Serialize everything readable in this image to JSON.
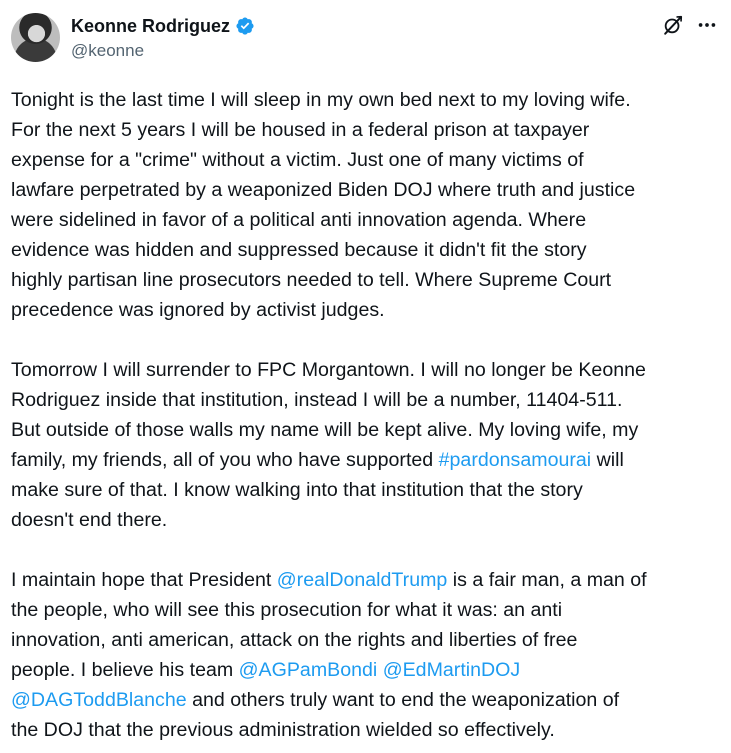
{
  "author": {
    "display_name": "Keonne Rodriguez",
    "handle": "@keonne",
    "verified": true,
    "verified_color": "#1d9bf0"
  },
  "actions": {
    "grok_icon": "grok-icon",
    "more_icon": "more-horizontal-icon"
  },
  "colors": {
    "text": "#0f1419",
    "secondary": "#536471",
    "link": "#1d9bf0"
  },
  "paragraphs": [
    {
      "lines": [
        [
          {
            "t": "Tonight is the last time I will sleep in my own bed next to my loving wife."
          }
        ],
        [
          {
            "t": "For the next 5 years I will be housed in a federal prison at taxpayer"
          }
        ],
        [
          {
            "t": "expense for a \"crime\" without a victim. Just one of many victims of"
          }
        ],
        [
          {
            "t": "lawfare perpetrated by a weaponized Biden DOJ where truth and justice"
          }
        ],
        [
          {
            "t": "were sidelined in favor of a political anti innovation agenda. Where"
          }
        ],
        [
          {
            "t": "evidence was hidden and suppressed because it didn't fit the story"
          }
        ],
        [
          {
            "t": "highly partisan line prosecutors needed to tell. Where Supreme Court"
          }
        ],
        [
          {
            "t": "precedence was ignored by activist judges."
          }
        ]
      ]
    },
    {
      "lines": [
        [
          {
            "t": "Tomorrow I will surrender to FPC Morgantown. I will no longer be Keonne"
          }
        ],
        [
          {
            "t": "Rodriguez inside that institution, instead I will be a number, 11404-511."
          }
        ],
        [
          {
            "t": "But outside of those walls my name will be kept alive. My loving wife, my"
          }
        ],
        [
          {
            "t": "family, my friends, all of you who have supported "
          },
          {
            "t": "#pardonsamourai",
            "link": true
          },
          {
            "t": " will"
          }
        ],
        [
          {
            "t": "make sure of that. I know walking into that institution that the story"
          }
        ],
        [
          {
            "t": "doesn't end there."
          }
        ]
      ]
    },
    {
      "lines": [
        [
          {
            "t": "I maintain hope that President "
          },
          {
            "t": "@realDonaldTrump",
            "link": true
          },
          {
            "t": " is a fair man, a man of"
          }
        ],
        [
          {
            "t": "the people, who will see this prosecution for what it was: an anti"
          }
        ],
        [
          {
            "t": "innovation, anti american, attack on the rights and liberties of free"
          }
        ],
        [
          {
            "t": "people. I believe his team "
          },
          {
            "t": "@AGPamBondi",
            "link": true
          },
          {
            "t": " "
          },
          {
            "t": "@EdMartinDOJ",
            "link": true
          }
        ],
        [
          {
            "t": "@DAGToddBlanche",
            "link": true
          },
          {
            "t": " and others truly want to end the weaponization of"
          }
        ],
        [
          {
            "t": "the DOJ that the previous administration wielded so effectively."
          }
        ]
      ]
    }
  ]
}
